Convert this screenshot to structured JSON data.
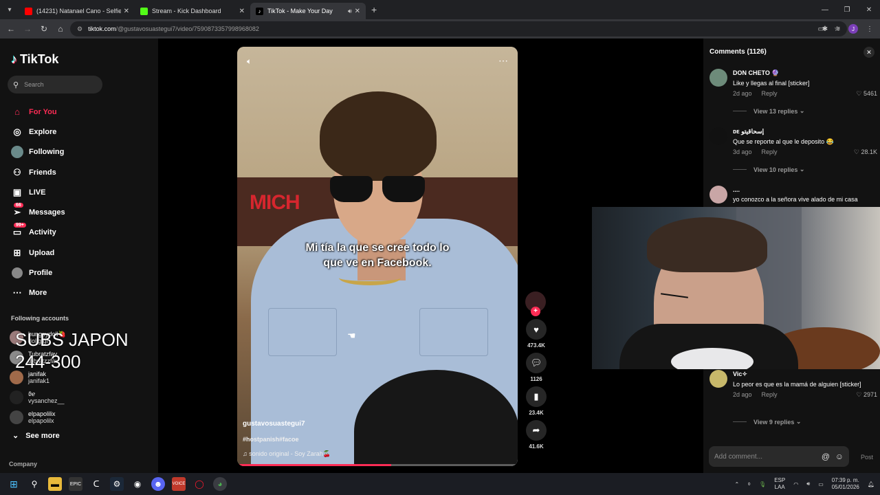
{
  "browser": {
    "tabs": [
      {
        "title": "(14231) Natanael Cano - Selfie",
        "favicon_color": "#ff0000",
        "active": false
      },
      {
        "title": "Stream - Kick Dashboard",
        "favicon_color": "#53fc18",
        "active": false
      },
      {
        "title": "TikTok - Make Your Day",
        "favicon_color": "#000000",
        "active": true
      }
    ],
    "url_host": "tiktok.com",
    "url_path": "/@gustavosuastegui7/video/7590873357998968082",
    "profile_initial": "J"
  },
  "sidebar": {
    "logo": "TikTok",
    "search_placeholder": "Search",
    "nav": [
      {
        "label": "For You",
        "icon": "home-icon",
        "active": true
      },
      {
        "label": "Explore",
        "icon": "compass-icon"
      },
      {
        "label": "Following",
        "icon": "following-icon"
      },
      {
        "label": "Friends",
        "icon": "friends-icon"
      },
      {
        "label": "LIVE",
        "icon": "live-icon"
      },
      {
        "label": "Messages",
        "icon": "messages-icon",
        "badge": "66"
      },
      {
        "label": "Activity",
        "icon": "activity-icon",
        "badge": "99+"
      },
      {
        "label": "Upload",
        "icon": "upload-icon"
      },
      {
        "label": "Profile",
        "icon": "profile-icon"
      },
      {
        "label": "More",
        "icon": "more-icon"
      }
    ],
    "following_header": "Following accounts",
    "accounts": [
      {
        "name": "hungpydoll🍓",
        "handle": "dollgfgf"
      },
      {
        "name": "Tubratzfav",
        "handle": "tbbratzzfav"
      },
      {
        "name": "janifak",
        "handle": "janifak1"
      },
      {
        "name": "ϑℯ",
        "handle": "vysanchez__"
      },
      {
        "name": "elpapolilix",
        "handle": "elpapolilx"
      }
    ],
    "see_more": "See more",
    "company": "Company",
    "stream_overlay": [
      "SUBS JAPON",
      "244-300"
    ]
  },
  "video": {
    "caption_lines": [
      "Mi tía la que se cree todo lo",
      "que ve en Facebook."
    ],
    "author": "gustavosuastegui7",
    "tags": "#hostpanish#facoe",
    "sound": "sonido original - Soy Zarah🍒",
    "store_sign": "MICH",
    "progress": 0.55
  },
  "actions": {
    "likes": "473.4K",
    "comments": "1126",
    "saves": "23.4K",
    "shares": "41.6K"
  },
  "comments_panel": {
    "title": "Comments (1126)",
    "comments": [
      {
        "user": "DON CHETO 🔮",
        "text": "Like y llegas al final [sticker]",
        "time": "2d ago",
        "reply": "Reply",
        "likes": "5461",
        "view_replies": "View 13 replies"
      },
      {
        "user": "ᴅᴇ إسحاقيتو",
        "text": "Que se reporte al que le deposito 😂",
        "time": "3d ago",
        "reply": "Reply",
        "likes": "28.1K",
        "view_replies": "View 10 replies"
      },
      {
        "user": "....",
        "text": "yo conozco a la señora vive alado de mi casa"
      },
      {
        "user": "Vic✧",
        "text": "Lo peor es que es la mamá de alguien [sticker]",
        "time": "2d ago",
        "reply": "Reply",
        "likes": "2971",
        "view_replies": "View 9 replies"
      }
    ],
    "input_placeholder": "Add comment...",
    "post": "Post"
  },
  "taskbar": {
    "lang_top": "ESP",
    "lang_bottom": "LAA",
    "time": "07:39 p. m.",
    "date": "05/01/2026"
  }
}
